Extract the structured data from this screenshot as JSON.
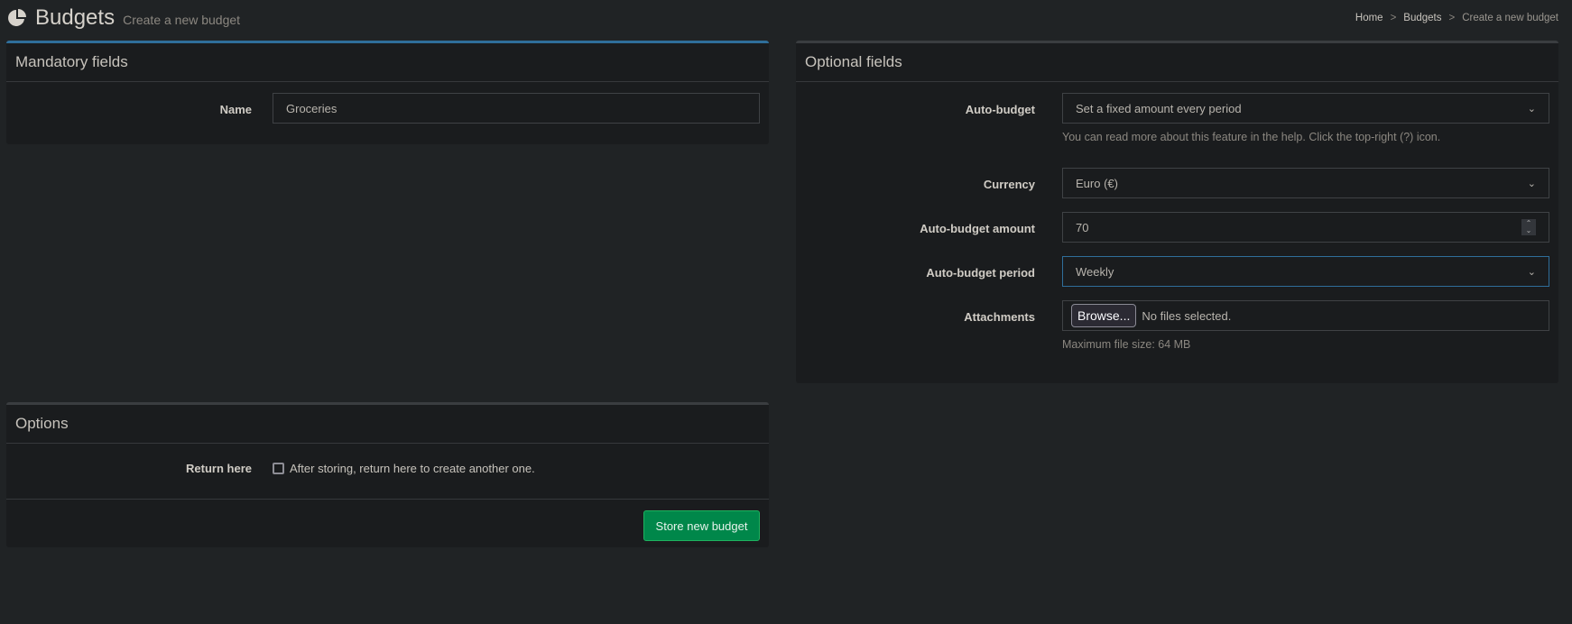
{
  "header": {
    "title": "Budgets",
    "subtitle": "Create a new budget",
    "icon": "pie-chart-icon"
  },
  "breadcrumb": {
    "items": [
      "Home",
      "Budgets",
      "Create a new budget"
    ],
    "separator": ">"
  },
  "mandatory": {
    "title": "Mandatory fields",
    "name_label": "Name",
    "name_value": "Groceries"
  },
  "optional": {
    "title": "Optional fields",
    "auto_budget_label": "Auto-budget",
    "auto_budget_value": "Set a fixed amount every period",
    "auto_budget_help": "You can read more about this feature in the help. Click the top-right (?) icon.",
    "currency_label": "Currency",
    "currency_value": "Euro (€)",
    "amount_label": "Auto-budget amount",
    "amount_value": "70",
    "period_label": "Auto-budget period",
    "period_value": "Weekly",
    "attachments_label": "Attachments",
    "browse_label": "Browse...",
    "no_files": "No files selected.",
    "max_size": "Maximum file size: 64 MB"
  },
  "options": {
    "title": "Options",
    "return_label": "Return here",
    "return_text": "After storing, return here to create another one.",
    "return_checked": false,
    "submit_label": "Store new budget"
  },
  "colors": {
    "accent": "#2f6e9a",
    "submit": "#00874a",
    "background": "#202325",
    "panel": "#1a1c1e"
  }
}
